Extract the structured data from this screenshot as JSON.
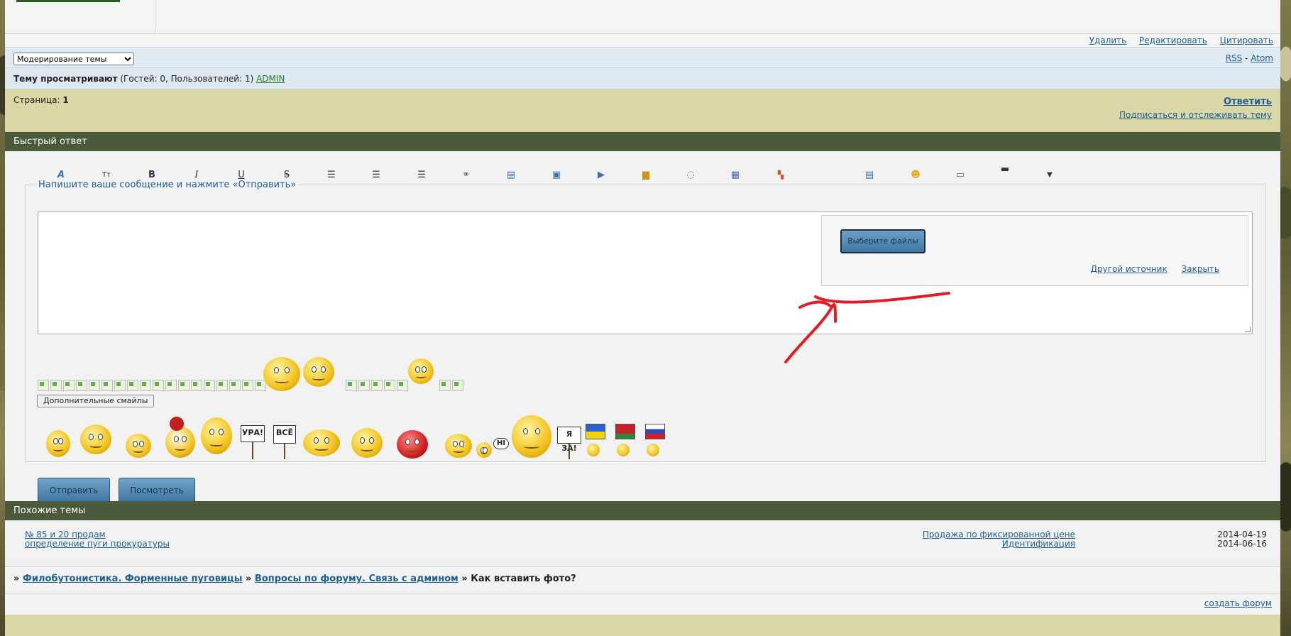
{
  "actions": {
    "delete": "Удалить",
    "edit": "Редактировать",
    "quote": "Цитировать"
  },
  "moderation": {
    "select_value": "Модерирование темы"
  },
  "feeds": {
    "rss": "RSS",
    "sep": "-",
    "atom": "Atom"
  },
  "viewers": {
    "label": "Тему просматривают",
    "counts": "(Гостей: 0, Пользователей: 1)",
    "user": "ADMIN"
  },
  "pagination": {
    "label": "Страница:",
    "current": "1"
  },
  "reply_links": {
    "reply": "Ответить",
    "subscribe": "Подписаться и отслеживать тему"
  },
  "quick_reply": {
    "title": "Быстрый ответ",
    "legend": "Напишите ваше сообщение и нажмите «Отправить»",
    "uploader": {
      "choose_button": "Выберите файлы",
      "other_source": "Другой источник",
      "close": "Закрыть"
    },
    "more_smiles_button": "Дополнительные смайлы",
    "signs": {
      "ura": "УРА!",
      "vse": "ВСЁ",
      "hi": "HI",
      "ya_za": "Я ЗА!"
    },
    "submit_button": "Отправить",
    "preview_button": "Посмотреть"
  },
  "toolbar_icons": [
    "font-color-icon",
    "font-size-icon",
    "bold-icon",
    "italic-icon",
    "underline-icon",
    "strikethrough-icon",
    "align-left-icon",
    "align-center-icon",
    "align-right-icon",
    "link-icon",
    "book-icon",
    "image-icon",
    "video-icon",
    "lock-icon",
    "speech-bubble-icon",
    "document-icon",
    "table-icon",
    "list-icon",
    "smile-icon",
    "keyboard-icon",
    "code-icon",
    "more-dropdown-icon"
  ],
  "similar": {
    "title": "Похожие темы",
    "rows": [
      {
        "topic": "№ 85 и 20 продам",
        "section": "Продажа по фиксированной цене",
        "date": "2014-04-19"
      },
      {
        "topic": "определение пуги прокуратуры",
        "section": "Идентификация",
        "date": "2014-06-16"
      }
    ]
  },
  "breadcrumb": {
    "sep": "»",
    "forum": "Филобутонистика. Форменные пуговицы",
    "section": "Вопросы по форуму. Связь с админом",
    "current": "Как вставить фото?"
  },
  "footer": {
    "create_forum": "создать форум"
  },
  "colors": {
    "section_header": "#4a5a3a",
    "khaki_bar": "#d9d7a6",
    "link": "#1d5e96",
    "annotation": "#e31b23"
  }
}
